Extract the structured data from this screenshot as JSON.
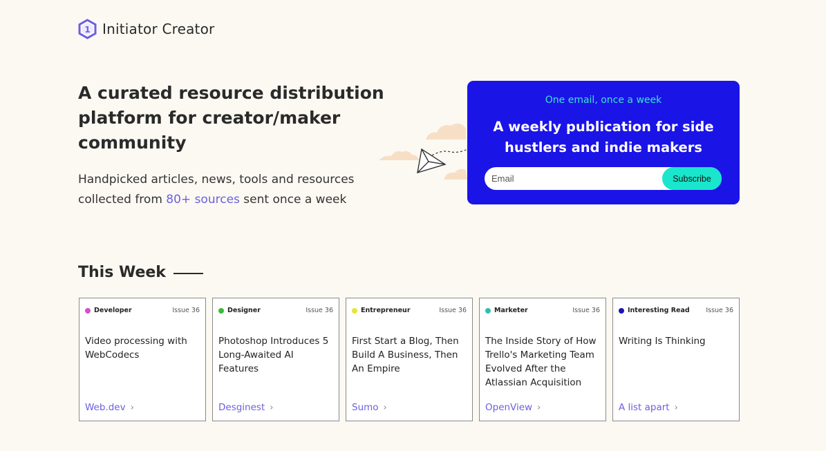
{
  "brand": {
    "name": "Initiator Creator",
    "logo_glyph": "1",
    "logo_color": "#6b5fe0"
  },
  "hero": {
    "title": "A curated resource distribution platform for creator/maker community",
    "subtitle_pre": "Handpicked articles, news, tools and resources collected from ",
    "subtitle_link": "80+ sources",
    "subtitle_post": " sent once a week"
  },
  "signup": {
    "kicker": "One email, once a week",
    "title": "A weekly publication for side hustlers and indie makers",
    "email_placeholder": "Email",
    "button": "Subscribe",
    "bg_color": "#1b14e6",
    "accent_color": "#19e6cc"
  },
  "section": {
    "title": "This Week"
  },
  "cards": [
    {
      "category": "Developer",
      "dot_color": "#d24fd0",
      "issue": "Issue 36",
      "title": "Video processing with WebCodecs",
      "source": "Web.dev"
    },
    {
      "category": "Designer",
      "dot_color": "#3cb83c",
      "issue": "Issue 36",
      "title": "Photoshop Introduces 5 Long-Awaited AI Features",
      "source": "Desginest"
    },
    {
      "category": "Entrepreneur",
      "dot_color": "#e6e633",
      "issue": "Issue 36",
      "title": "First Start a Blog, Then Build A Business, Then An Empire",
      "source": "Sumo"
    },
    {
      "category": "Marketer",
      "dot_color": "#2fbfb0",
      "issue": "Issue 36",
      "title": "The Inside Story of How Trello's Marketing Team Evolved After the Atlassian Acquisition",
      "source": "OpenView"
    },
    {
      "category": "Interesting Read",
      "dot_color": "#1b14b8",
      "issue": "Issue 36",
      "title": "Writing Is Thinking",
      "source": "A list apart"
    }
  ],
  "icons": {
    "source_arrow": "chevron-right-icon",
    "decoration": "paper-plane-icon"
  }
}
